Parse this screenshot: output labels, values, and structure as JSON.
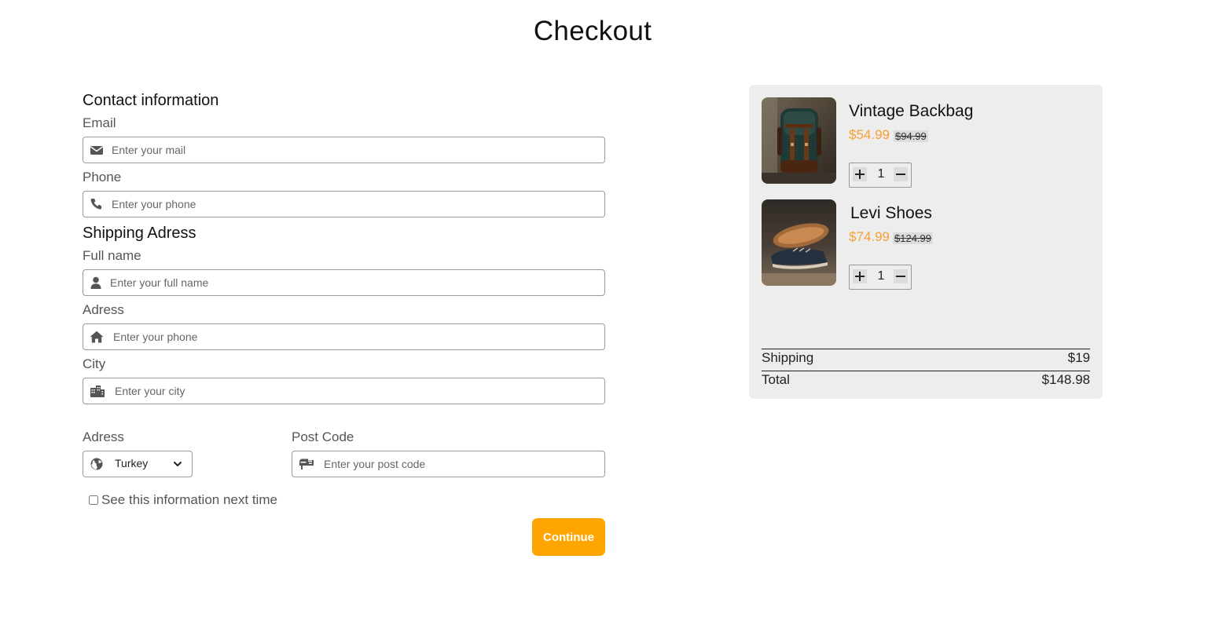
{
  "page": {
    "title": "Checkout"
  },
  "contact": {
    "heading": "Contact information",
    "email_label": "Email",
    "email_placeholder": "Enter your mail",
    "email_value": "",
    "phone_label": "Phone",
    "phone_placeholder": "Enter your phone",
    "phone_value": ""
  },
  "shipping": {
    "heading": "Shipping Adress",
    "fullname_label": "Full name",
    "fullname_placeholder": "Enter your full name",
    "fullname_value": "",
    "address_label": "Adress",
    "address_placeholder": "Enter your phone",
    "address_value": "",
    "city_label": "City",
    "city_placeholder": "Enter your city",
    "city_value": "",
    "country_label": "Adress",
    "country_value": "Turkey",
    "postcode_label": "Post Code",
    "postcode_placeholder": "Enter your post code",
    "postcode_value": ""
  },
  "remember": {
    "label": "See this information next time",
    "checked": false
  },
  "continue_label": "Continue",
  "cart": {
    "items": [
      {
        "name": "Vintage Backbag",
        "price": "$54.99",
        "old_price": "$94.99",
        "quantity": "1"
      },
      {
        "name": "Levi Shoes",
        "price": "$74.99",
        "old_price": "$124.99",
        "quantity": "1"
      }
    ],
    "shipping_label": "Shipping",
    "shipping_value": "$19",
    "total_label": "Total",
    "total_value": "$148.98"
  },
  "icons": {
    "email": "envelope-icon",
    "phone": "phone-icon",
    "fullname": "user-icon",
    "address": "home-icon",
    "city": "city-icon",
    "country": "globe-icon",
    "select": "chevron-down-icon",
    "postcode": "mailbox-icon",
    "qty_plus": "plus-icon",
    "qty_minus": "minus-icon"
  },
  "colors": {
    "accent": "#ffa500",
    "price": "#f6a032",
    "panel": "#ededed"
  }
}
